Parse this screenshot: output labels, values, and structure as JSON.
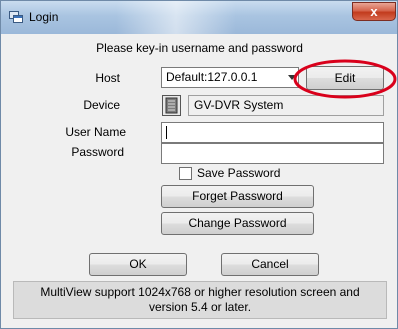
{
  "window": {
    "title": "Login",
    "close_label": "x"
  },
  "prompt": "Please key-in username and password",
  "host": {
    "label": "Host",
    "value": "Default:127.0.0.1",
    "edit_label": "Edit"
  },
  "device": {
    "label": "Device",
    "value": "GV-DVR System"
  },
  "username": {
    "label": "User Name",
    "value": ""
  },
  "password": {
    "label": "Password",
    "value": ""
  },
  "save_password": {
    "label": "Save Password",
    "checked": false
  },
  "buttons": {
    "forget": "Forget Password",
    "change": "Change Password",
    "ok": "OK",
    "cancel": "Cancel"
  },
  "info": {
    "line1": "MultiView support 1024x768 or higher resolution screen and",
    "line2": "version 5.4 or later."
  },
  "colors": {
    "highlight": "#d9001b"
  }
}
